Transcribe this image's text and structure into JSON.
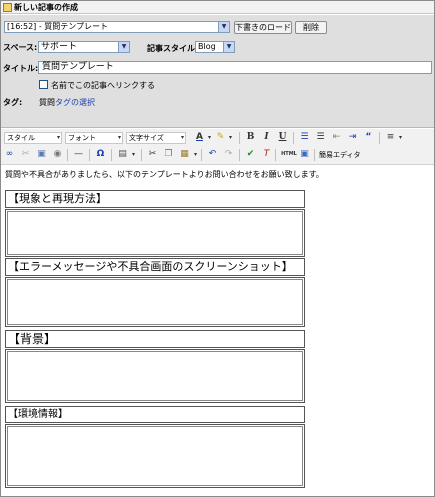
{
  "window": {
    "title": "新しい記事の作成"
  },
  "form": {
    "template_select": "[16:52] - 質問テンプレート",
    "load_draft_button": "下書きのロード",
    "delete_button": "削除",
    "space_label": "スペース:",
    "space_value": "サポート",
    "article_style_label": "記事スタイル",
    "article_style_value": "Blog",
    "title_label": "タイトル:",
    "title_value": "質問テンプレート",
    "anon_link_label": "名前でこの記事へリンクする",
    "tag_label": "タグ:",
    "tag_value": "質問",
    "tag_select_link": "タグの選択"
  },
  "toolbar": {
    "style_select": "スタイル",
    "font_select": "フォント",
    "size_select": "文字サイズ",
    "bold": "B",
    "italic": "I",
    "underline": "U",
    "omega": "Ω",
    "html": "HTML",
    "simple_editor": "簡易エディタ"
  },
  "content": {
    "intro": "質問や不具合がありましたら、以下のテンプレートよりお問い合わせをお願い致します。",
    "sections": [
      {
        "heading": "【現象と再現方法】"
      },
      {
        "heading": "【エラーメッセージや不具合画面のスクリーンショット】"
      },
      {
        "heading": "【背景】"
      },
      {
        "heading": "【環境情報】"
      }
    ]
  }
}
